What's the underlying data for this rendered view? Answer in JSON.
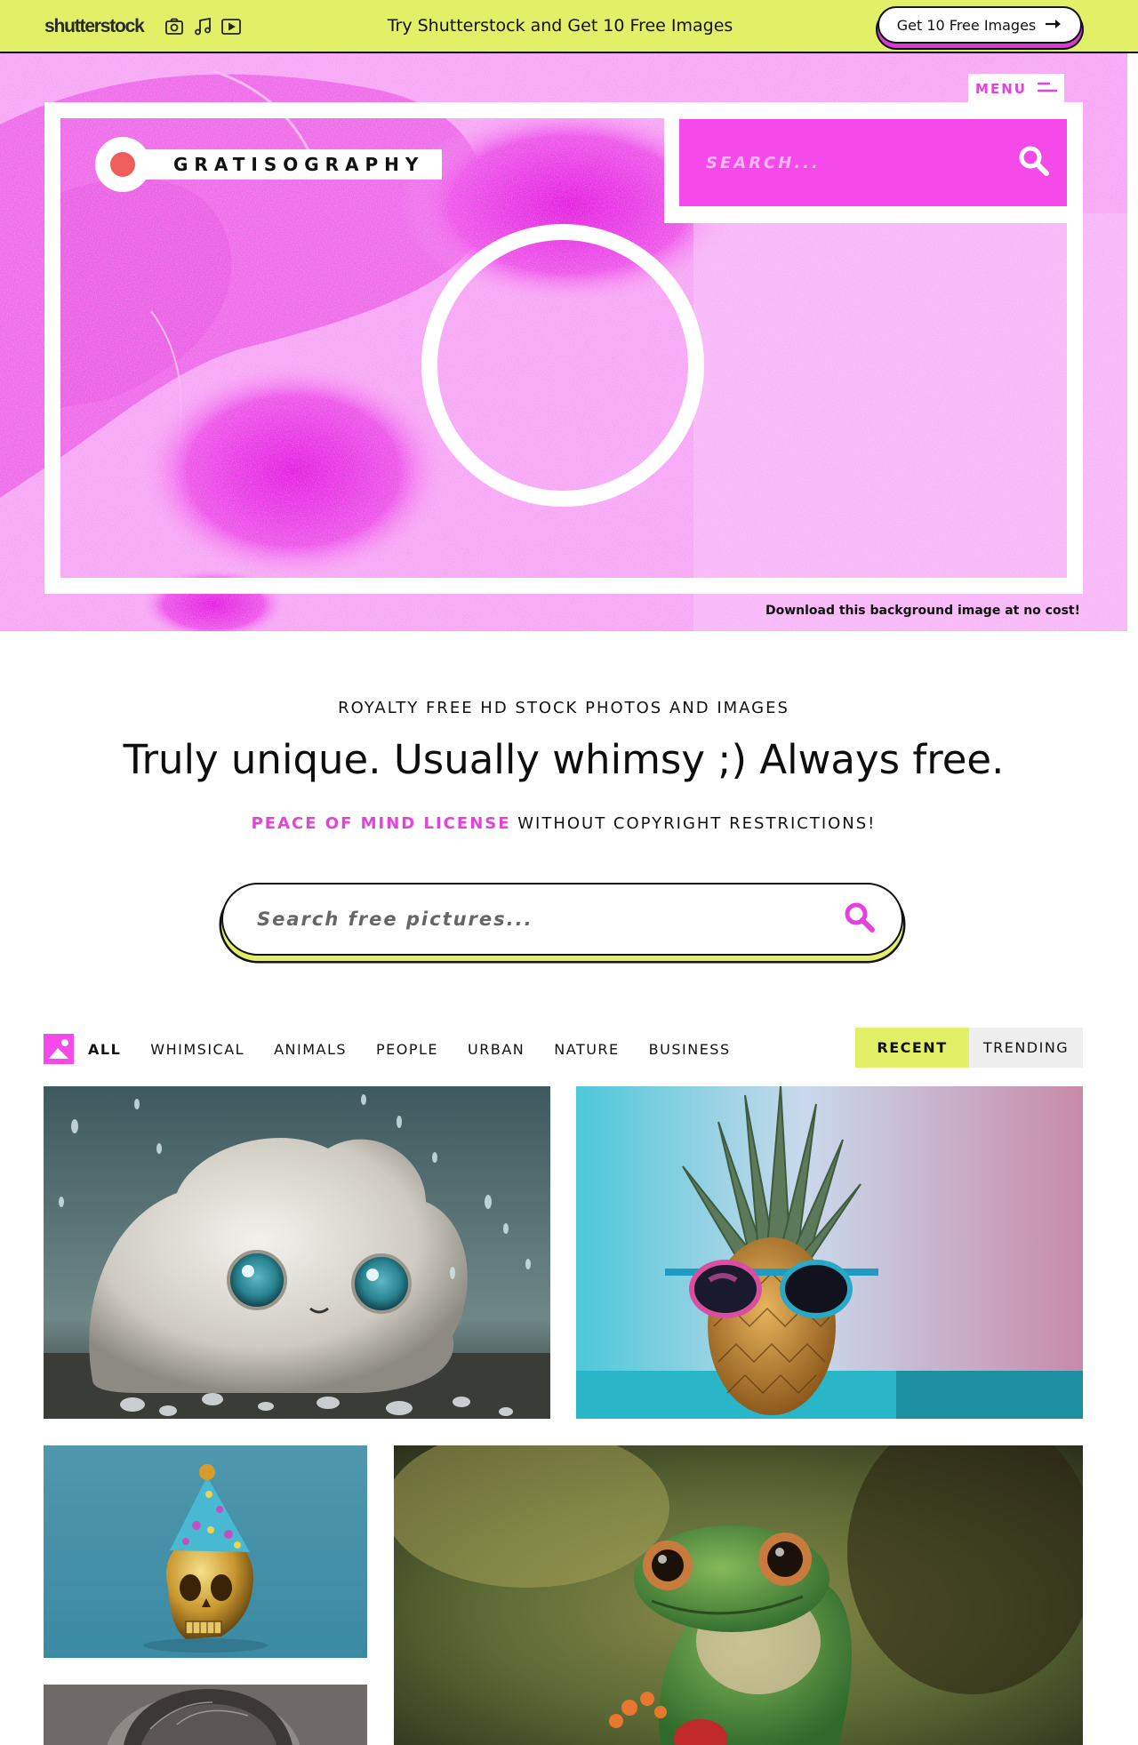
{
  "promo_bar": {
    "logo_text": "shutterstock",
    "icons": [
      "camera-icon",
      "music-note-icon",
      "video-play-icon"
    ],
    "message": "Try Shutterstock and Get 10 Free Images",
    "cta_label": "Get 10 Free Images",
    "cta_icon": "arrow-right-icon",
    "background_color": "#e2f067"
  },
  "hero": {
    "menu_label": "MENU",
    "menu_icon": "hamburger-icon",
    "brand_name": "GRATISOGRAPHY",
    "search_placeholder": "SEARCH...",
    "search_icon": "search-icon",
    "caption": "Download this background image at no cost!",
    "accent_color": "#f54ae9"
  },
  "intro": {
    "eyebrow": "ROYALTY FREE HD STOCK PHOTOS AND IMAGES",
    "headline": "Truly unique. Usually whimsy ;) Always free.",
    "license_accent": "PEACE OF MIND LICENSE",
    "license_rest": " WITHOUT COPYRIGHT RESTRICTIONS!"
  },
  "main_search": {
    "placeholder": "Search free pictures...",
    "icon": "search-icon"
  },
  "filters": {
    "icon": "image-category-icon",
    "items": [
      "ALL",
      "WHIMSICAL",
      "ANIMALS",
      "PEOPLE",
      "URBAN",
      "NATURE",
      "BUSINESS"
    ],
    "active": "ALL"
  },
  "sort": {
    "tabs": [
      "RECENT",
      "TRENDING"
    ],
    "active": "RECENT"
  },
  "gallery": [
    {
      "subject": "fluffy-cloud-creature-photo"
    },
    {
      "subject": "pineapple-with-sunglasses-photo"
    },
    {
      "subject": "golden-skull-party-hat-photo"
    },
    {
      "subject": "frog-photo"
    },
    {
      "subject": "person-portrait-photo"
    }
  ]
}
